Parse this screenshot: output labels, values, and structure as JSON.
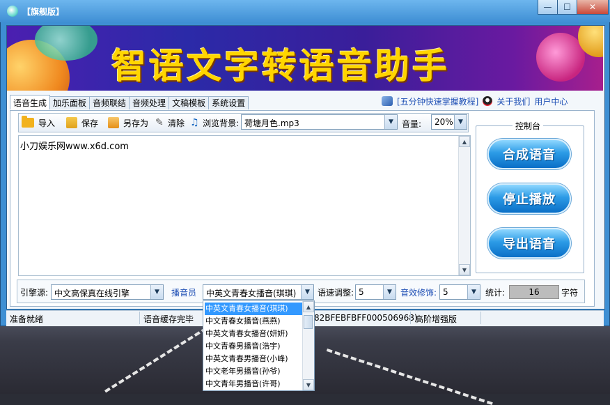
{
  "window": {
    "title": "【旗舰版】",
    "controls": {
      "minimize": "—",
      "maximize": "☐",
      "close": "✕"
    }
  },
  "banner": {
    "title": "智语文字转语音助手"
  },
  "tabs": [
    "语音生成",
    "加乐面板",
    "音频联结",
    "音频处理",
    "文稿模板",
    "系统设置"
  ],
  "toplinks": {
    "tutorial": "[五分钟快速掌握教程]",
    "about": "关于我们",
    "user_center": "用户中心"
  },
  "toolbar": {
    "import": "导入",
    "save": "保存",
    "save_as": "另存为",
    "clear": "清除",
    "browse_bg": "浏览背景:",
    "bg_file": "荷塘月色.mp3",
    "volume_label": "音量:",
    "volume_value": "20%"
  },
  "editor": {
    "text": "小刀娱乐网www.x6d.com"
  },
  "control_panel": {
    "title": "控制台",
    "synthesize": "合成语音",
    "stop": "停止播放",
    "export": "导出语音"
  },
  "bottom": {
    "engine_label": "引擎源:",
    "engine_value": "中文高保真在线引擎",
    "speaker_label": "播音员",
    "speaker_value": "中英文青春女播音(琪琪)",
    "speed_label": "语速调整:",
    "speed_value": "5",
    "effect_label": "音效修饰:",
    "effect_value": "5",
    "count_label": "统计:",
    "count_value": "16",
    "count_unit": "字符"
  },
  "status": {
    "ready": "准备就绪",
    "cache": "语音缓存完毕",
    "machine_id": "82BFEBFBFF000506968)",
    "edition": "高阶增强版"
  },
  "dropdown": {
    "options": [
      "中英文青春女播音(琪琪)",
      "中文青春女播音(燕燕)",
      "中英文青春女播音(妍妍)",
      "中文青春男播音(浩宇)",
      "中英文青春男播音(小峰)",
      "中文老年男播音(孙爷)",
      "中文青年男播音(许哥)"
    ],
    "selected_index": 0
  }
}
